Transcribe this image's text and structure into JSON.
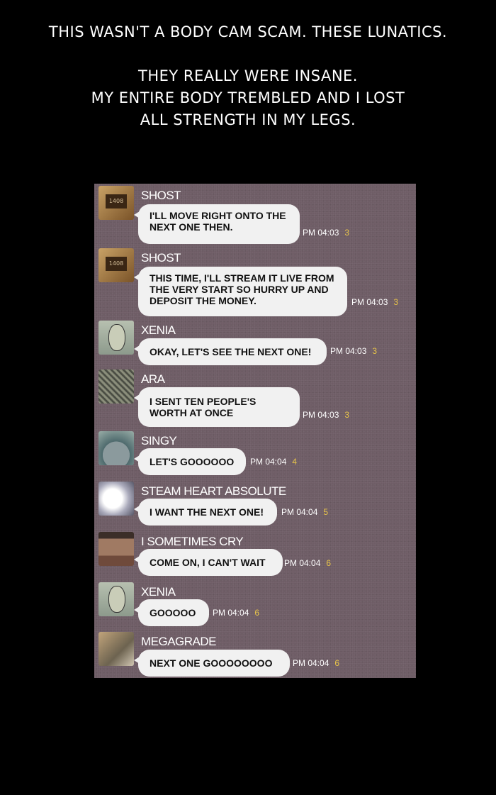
{
  "narration": {
    "line1": "THIS WASN'T A BODY CAM SCAM. THESE LUNATICS.",
    "line2": "THEY REALLY WERE INSANE.",
    "line3": "MY ENTIRE BODY TREMBLED AND I LOST",
    "line4": "ALL STRENGTH IN MY LEGS."
  },
  "chat": {
    "avatar_ghost_text": "1408",
    "messages": [
      {
        "name": "SHOST",
        "text": "I'LL MOVE RIGHT ONTO THE\nNEXT ONE THEN.",
        "time": "PM 04:03",
        "count": "3"
      },
      {
        "name": "SHOST",
        "text": "THIS TIME, I'LL STREAM IT LIVE FROM\nTHE VERY START SO HURRY UP AND\nDEPOSIT THE MONEY.",
        "time": "PM 04:03",
        "count": "3"
      },
      {
        "name": "XENIA",
        "text": "OKAY, LET'S SEE THE NEXT ONE!",
        "time": "PM 04:03",
        "count": "3"
      },
      {
        "name": "ARA",
        "text": "I SENT TEN PEOPLE'S\nWORTH AT ONCE",
        "time": "PM 04:03",
        "count": "3"
      },
      {
        "name": "SINGY",
        "text": "LET'S GOOOOOO",
        "time": "PM 04:04",
        "count": "4"
      },
      {
        "name": "STEAM HEART ABSOLUTE",
        "text": "I WANT THE NEXT ONE!",
        "time": "PM 04:04",
        "count": "5"
      },
      {
        "name": "I SOMETIMES CRY",
        "text": "COME ON, I CAN'T WAIT",
        "time": "PM 04:04",
        "count": "6"
      },
      {
        "name": "XENIA",
        "text": "GOOOOO",
        "time": "PM 04:04",
        "count": "6"
      },
      {
        "name": "MEGAGRADE",
        "text": "NEXT ONE GOOOOOOOO",
        "time": "PM 04:04",
        "count": "6"
      }
    ]
  }
}
